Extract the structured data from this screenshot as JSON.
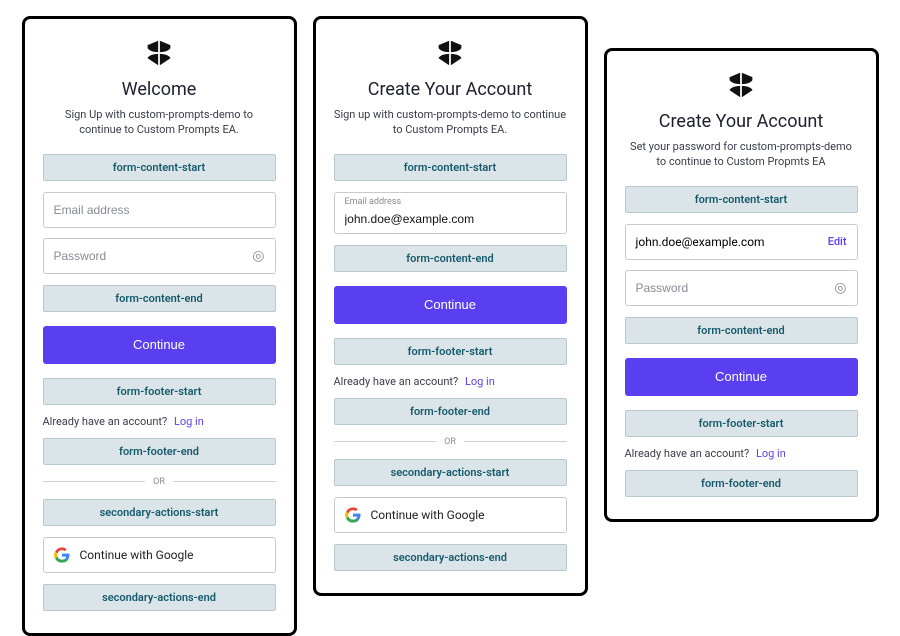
{
  "slots": {
    "form_content_start": "form-content-start",
    "form_content_end": "form-content-end",
    "form_footer_start": "form-footer-start",
    "form_footer_end": "form-footer-end",
    "secondary_actions_start": "secondary-actions-start",
    "secondary_actions_end": "secondary-actions-end"
  },
  "common": {
    "divider_label": "OR",
    "google_label": "Continue with Google",
    "continue_label": "Continue"
  },
  "screen1": {
    "title": "Welcome",
    "subtitle": "Sign Up with custom-prompts-demo to continue to Custom Prompts EA.",
    "email_placeholder": "Email address",
    "password_placeholder": "Password",
    "alt_prompt": "Already have an account?",
    "alt_link": "Log in"
  },
  "screen2": {
    "title": "Create Your Account",
    "subtitle": "Sign up with custom-prompts-demo to continue to Custom Prompts EA.",
    "email_label": "Email address",
    "email_value": "john.doe@example.com",
    "alt_prompt": "Already have an account?",
    "alt_link": "Log in"
  },
  "screen3": {
    "title": "Create Your Account",
    "subtitle": "Set your password for custom-prompts-demo to continue to Custom Propmts EA",
    "email_value": "john.doe@example.com",
    "edit_label": "Edit",
    "password_placeholder": "Password",
    "alt_prompt": "Already have an account?",
    "alt_link": "Log in"
  }
}
